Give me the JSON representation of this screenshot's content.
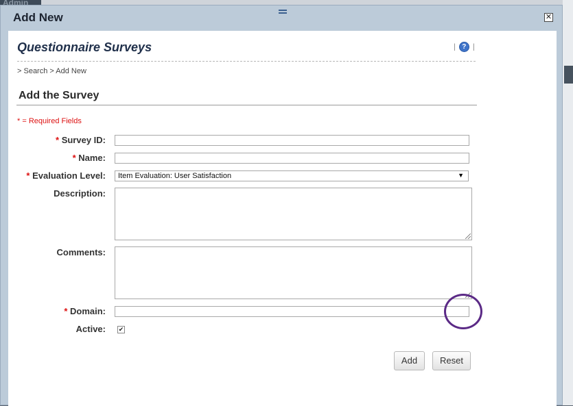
{
  "background": {
    "admin_label": "Admin"
  },
  "modal": {
    "title": "Add New",
    "close_glyph": "✕"
  },
  "page": {
    "title": "Questionnaire Surveys",
    "help_icon": "help-icon",
    "breadcrumb": {
      "sep1": "> ",
      "search": "Search",
      "sep2": " > ",
      "current": "Add New"
    },
    "section_title": "Add the Survey",
    "required_note": "* = Required Fields"
  },
  "form": {
    "survey_id": {
      "label": "Survey ID:",
      "required": "*",
      "value": ""
    },
    "name": {
      "label": "Name:",
      "required": "*",
      "value": ""
    },
    "evaluation_level": {
      "label": "Evaluation Level:",
      "required": "*",
      "selected": "Item Evaluation: User Satisfaction"
    },
    "description": {
      "label": "Description:",
      "value": ""
    },
    "comments": {
      "label": "Comments:",
      "value": ""
    },
    "domain": {
      "label": "Domain:",
      "required": "*",
      "value": ""
    },
    "active": {
      "label": "Active:",
      "checked": true,
      "check_glyph": "✔"
    }
  },
  "buttons": {
    "add": "Add",
    "reset": "Reset"
  },
  "colors": {
    "accent": "#3f74c9",
    "required": "#dd1111",
    "highlight_circle": "#5b2a86"
  }
}
